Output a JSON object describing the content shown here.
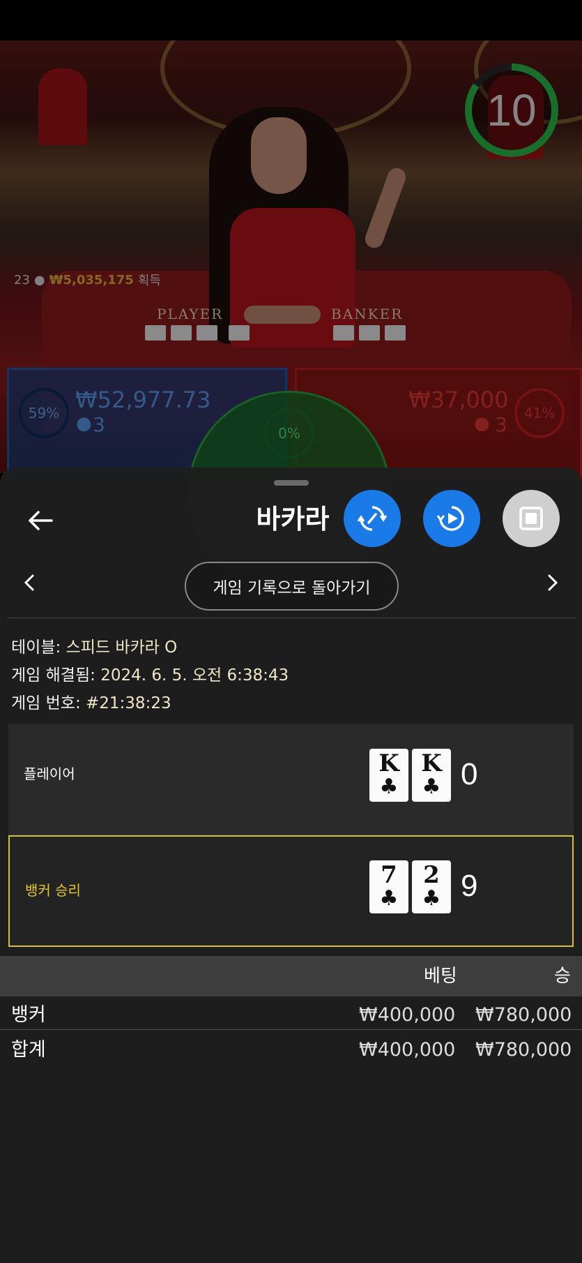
{
  "video": {
    "timer": "10",
    "winners_count": "23",
    "winners_amount": "₩5,035,175",
    "winners_suffix": "획득",
    "felt_player": "PLAYER",
    "felt_banker": "BANKER",
    "player_spot": {
      "percent": "59%",
      "amount": "₩52,977.73",
      "count": "3"
    },
    "banker_spot": {
      "percent": "41%",
      "amount": "₩37,000",
      "count": "3"
    },
    "tie_spot": {
      "percent": "0%"
    }
  },
  "sheet": {
    "title": "바카라",
    "back_to_history": "게임 기록으로 돌아가기",
    "table_label": "테이블:",
    "table_value": "스피드 바카라 O",
    "resolved_label": "게임 해결됨:",
    "resolved_value": "2024. 6. 5. 오전 6:38:43",
    "game_no_label": "게임 번호:",
    "game_no_value": "#21:38:23",
    "player_row": {
      "label": "플레이어",
      "cards": [
        {
          "rank": "K",
          "suit": "♣"
        },
        {
          "rank": "K",
          "suit": "♣"
        }
      ],
      "score": "0"
    },
    "banker_row": {
      "label": "뱅커 승리",
      "cards": [
        {
          "rank": "7",
          "suit": "♣"
        },
        {
          "rank": "2",
          "suit": "♣"
        }
      ],
      "score": "9"
    },
    "bets_table": {
      "col_bet": "베팅",
      "col_win": "승",
      "rows": [
        {
          "name": "뱅커",
          "bet": "₩400,000",
          "win": "₩780,000"
        }
      ],
      "total": {
        "name": "합계",
        "bet": "₩400,000",
        "win": "₩780,000"
      }
    }
  },
  "colors": {
    "accent_blue": "#1a7ae8",
    "banker_win_gold": "#d9c02a",
    "timer_green": "#2bbd4a",
    "player_blue": "#1e5bb8",
    "banker_red": "#c42020"
  },
  "icons": {
    "back": "arrow-left-icon",
    "history_refresh": "sync-icon",
    "replay": "replay-icon",
    "stop": "stop-icon",
    "prev": "chevron-left-icon",
    "next": "chevron-right-icon"
  }
}
